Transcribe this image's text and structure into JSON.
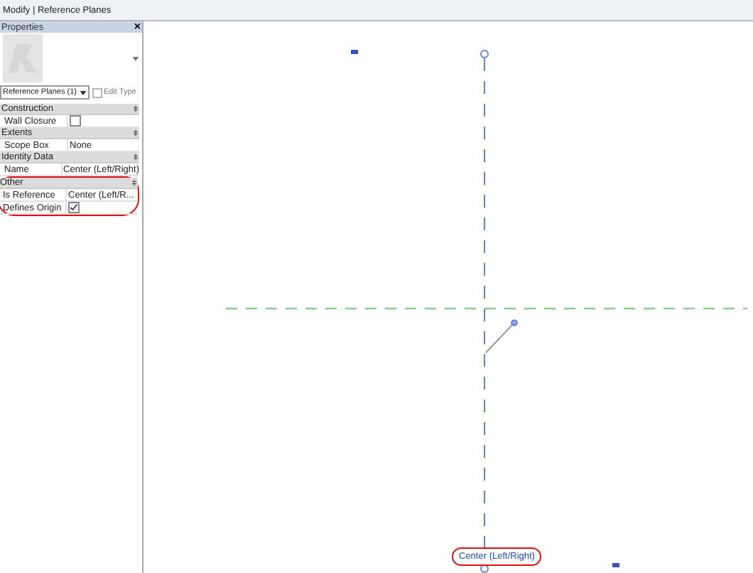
{
  "title": "Modify | Reference Planes",
  "properties": {
    "title": "Properties",
    "close": "×",
    "selector": "Reference Planes (1)",
    "edit_type": "Edit Type",
    "groups": [
      {
        "name": "Construction",
        "highlighted": false,
        "rows": [
          {
            "label": "Wall Closure",
            "kind": "checkbox",
            "checked": false
          }
        ]
      },
      {
        "name": "Extents",
        "highlighted": false,
        "rows": [
          {
            "label": "Scope Box",
            "kind": "text",
            "value": "None"
          }
        ]
      },
      {
        "name": "Identity Data",
        "highlighted": false,
        "rows": [
          {
            "label": "Name",
            "kind": "text",
            "value": "Center (Left/Right)"
          }
        ]
      },
      {
        "name": "Other",
        "highlighted": true,
        "rows": [
          {
            "label": "Is Reference",
            "kind": "text",
            "value": "Center (Left/R..."
          },
          {
            "label": "Defines Origin",
            "kind": "checkbox",
            "checked": true
          }
        ]
      }
    ]
  },
  "canvas": {
    "plane_label": "Center (Left/Right)",
    "label_highlighted": true
  }
}
